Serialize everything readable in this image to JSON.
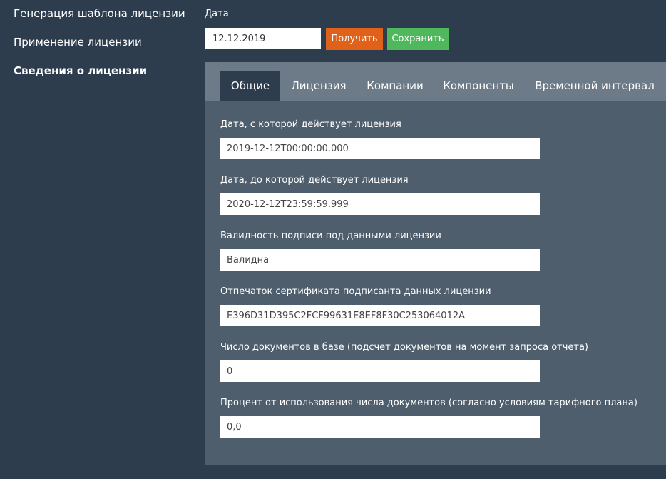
{
  "nav": {
    "items": [
      {
        "label": "Генерация шаблона лицензии"
      },
      {
        "label": "Применение лицензии"
      },
      {
        "label": "Сведения о лицензии"
      }
    ]
  },
  "controls": {
    "date_label": "Дата",
    "date_value": "12.12.2019",
    "get_button": "Получить",
    "save_button": "Сохранить"
  },
  "tabs": [
    {
      "label": "Общие"
    },
    {
      "label": "Лицензия"
    },
    {
      "label": "Компании"
    },
    {
      "label": "Компоненты"
    },
    {
      "label": "Временной интервал"
    }
  ],
  "fields": [
    {
      "label": "Дата, с которой действует лицензия",
      "value": "2019-12-12T00:00:00.000"
    },
    {
      "label": "Дата, до которой действует лицензия",
      "value": "2020-12-12T23:59:59.999"
    },
    {
      "label": "Валидность подписи под данными лицензии",
      "value": "Валидна"
    },
    {
      "label": "Отпечаток сертификата подписанта данных лицензии",
      "value": "E396D31D395C2FCF99631E8EF8F30C253064012A"
    },
    {
      "label": "Число документов в базе (подсчет документов на момент запроса отчета)",
      "value": "0"
    },
    {
      "label": "Процент от использования числа документов (согласно условиям тарифного плана)",
      "value": "0,0"
    }
  ],
  "colors": {
    "background": "#2d3d4e",
    "panel": "#4f5e6c",
    "tabbar": "#6d7b89",
    "get_button": "#e0621a",
    "save_button": "#4fb85d"
  }
}
